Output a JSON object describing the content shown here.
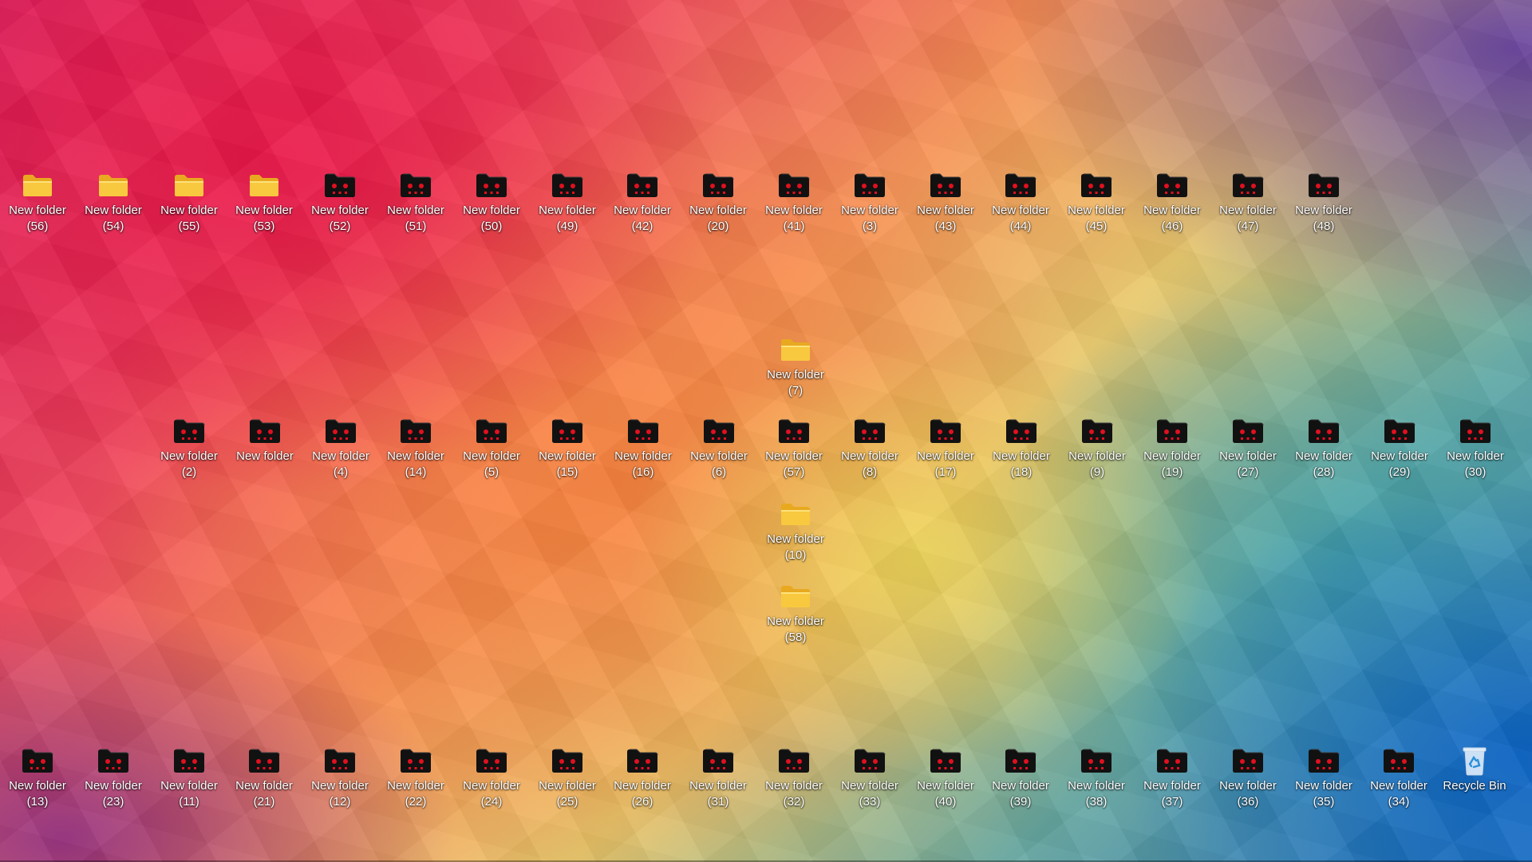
{
  "desktop": {
    "rows": [
      {
        "name": "row-top",
        "items": [
          {
            "label": "New folder (56)",
            "type": "folder"
          },
          {
            "label": "New folder (54)",
            "type": "folder"
          },
          {
            "label": "New folder (55)",
            "type": "folder"
          },
          {
            "label": "New folder (53)",
            "type": "folder"
          },
          {
            "label": "New folder (52)",
            "type": "red-eye-folder"
          },
          {
            "label": "New folder (51)",
            "type": "red-eye-folder"
          },
          {
            "label": "New folder (50)",
            "type": "red-eye-folder"
          },
          {
            "label": "New folder (49)",
            "type": "red-eye-folder"
          },
          {
            "label": "New folder (42)",
            "type": "red-eye-folder"
          },
          {
            "label": "New folder (20)",
            "type": "red-eye-folder"
          },
          {
            "label": "New folder (41)",
            "type": "red-eye-folder"
          },
          {
            "label": "New folder (3)",
            "type": "red-eye-folder"
          },
          {
            "label": "New folder (43)",
            "type": "red-eye-folder"
          },
          {
            "label": "New folder (44)",
            "type": "red-eye-folder"
          },
          {
            "label": "New folder (45)",
            "type": "red-eye-folder"
          },
          {
            "label": "New folder (46)",
            "type": "red-eye-folder"
          },
          {
            "label": "New folder (47)",
            "type": "red-eye-folder"
          },
          {
            "label": "New folder (48)",
            "type": "red-eye-folder"
          }
        ]
      },
      {
        "name": "row-middle",
        "items": [
          {
            "label": "New folder (2)",
            "type": "red-eye-folder"
          },
          {
            "label": "New folder",
            "type": "red-eye-folder"
          },
          {
            "label": "New folder (4)",
            "type": "red-eye-folder"
          },
          {
            "label": "New folder (14)",
            "type": "red-eye-folder"
          },
          {
            "label": "New folder (5)",
            "type": "red-eye-folder"
          },
          {
            "label": "New folder (15)",
            "type": "red-eye-folder"
          },
          {
            "label": "New folder (16)",
            "type": "red-eye-folder"
          },
          {
            "label": "New folder (6)",
            "type": "red-eye-folder"
          },
          {
            "label": "New folder (57)",
            "type": "red-eye-folder"
          },
          {
            "label": "New folder (8)",
            "type": "red-eye-folder"
          },
          {
            "label": "New folder (17)",
            "type": "red-eye-folder"
          },
          {
            "label": "New folder (18)",
            "type": "red-eye-folder"
          },
          {
            "label": "New folder (9)",
            "type": "red-eye-folder"
          },
          {
            "label": "New folder (19)",
            "type": "red-eye-folder"
          },
          {
            "label": "New folder (27)",
            "type": "red-eye-folder"
          },
          {
            "label": "New folder (28)",
            "type": "red-eye-folder"
          },
          {
            "label": "New folder (29)",
            "type": "red-eye-folder"
          },
          {
            "label": "New folder (30)",
            "type": "red-eye-folder"
          }
        ]
      },
      {
        "name": "row-bottom",
        "items": [
          {
            "label": "New folder (13)",
            "type": "red-eye-folder"
          },
          {
            "label": "New folder (23)",
            "type": "red-eye-folder"
          },
          {
            "label": "New folder (11)",
            "type": "red-eye-folder"
          },
          {
            "label": "New folder (21)",
            "type": "red-eye-folder"
          },
          {
            "label": "New folder (12)",
            "type": "red-eye-folder"
          },
          {
            "label": "New folder (22)",
            "type": "red-eye-folder"
          },
          {
            "label": "New folder (24)",
            "type": "red-eye-folder"
          },
          {
            "label": "New folder (25)",
            "type": "red-eye-folder"
          },
          {
            "label": "New folder (26)",
            "type": "red-eye-folder"
          },
          {
            "label": "New folder (31)",
            "type": "red-eye-folder"
          },
          {
            "label": "New folder (32)",
            "type": "red-eye-folder"
          },
          {
            "label": "New folder (33)",
            "type": "red-eye-folder"
          },
          {
            "label": "New folder (40)",
            "type": "red-eye-folder"
          },
          {
            "label": "New folder (39)",
            "type": "red-eye-folder"
          },
          {
            "label": "New folder (38)",
            "type": "red-eye-folder"
          },
          {
            "label": "New folder (37)",
            "type": "red-eye-folder"
          },
          {
            "label": "New folder (36)",
            "type": "red-eye-folder"
          },
          {
            "label": "New folder (35)",
            "type": "red-eye-folder"
          },
          {
            "label": "New folder (34)",
            "type": "red-eye-folder"
          },
          {
            "label": "Recycle Bin",
            "type": "recycle-bin"
          }
        ]
      },
      {
        "name": "column-center",
        "items": [
          {
            "label": "New folder (7)",
            "type": "folder"
          },
          {
            "label": "New folder (10)",
            "type": "folder"
          },
          {
            "label": "New folder (58)",
            "type": "folder"
          }
        ]
      }
    ]
  },
  "colors": {
    "folder_yellow": "#f8c83f",
    "folder_back": "#e8a920",
    "red_eye_body": "#111111",
    "red_eye_dot": "#e01020",
    "label_text": "#ffffff"
  },
  "icons": {
    "folder": "folder-icon",
    "red-eye-folder": "red-eye-folder-icon",
    "recycle-bin": "recycle-bin-icon"
  }
}
